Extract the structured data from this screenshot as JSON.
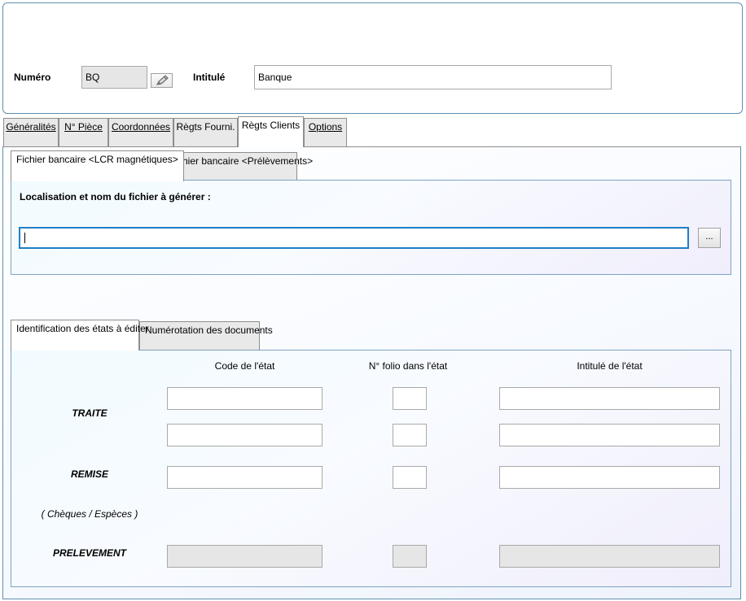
{
  "header": {
    "numero_label": "Numéro",
    "numero_value": "BQ",
    "intitule_label": "Intitulé",
    "intitule_value": "Banque"
  },
  "tabs": [
    {
      "label": "Généralités"
    },
    {
      "label": "N° Pièce"
    },
    {
      "label": "Coordonnées"
    },
    {
      "label": "Règts Fourni."
    },
    {
      "label": "Règts Clients"
    },
    {
      "label": "Options"
    }
  ],
  "file_section": {
    "tabs": [
      {
        "label": "Fichier bancaire <LCR magnétiques>"
      },
      {
        "label": "Fichier bancaire <Prélèvements>"
      }
    ],
    "location_label": "Localisation et nom du fichier à générer :",
    "file_value": "",
    "browse_label": "..."
  },
  "states_section": {
    "tabs": [
      {
        "label": "Identification des états à éditer"
      },
      {
        "label": "Numérotation des documents"
      }
    ],
    "columns": {
      "code": "Code de l'état",
      "folio": "N° folio dans l'état",
      "intitule": "Intitulé de l'état"
    },
    "rows": {
      "traite": "TRAITE",
      "remise": "REMISE",
      "remise_note": "( Chèques / Espèces )",
      "prelevement": "PRELEVEMENT"
    }
  }
}
